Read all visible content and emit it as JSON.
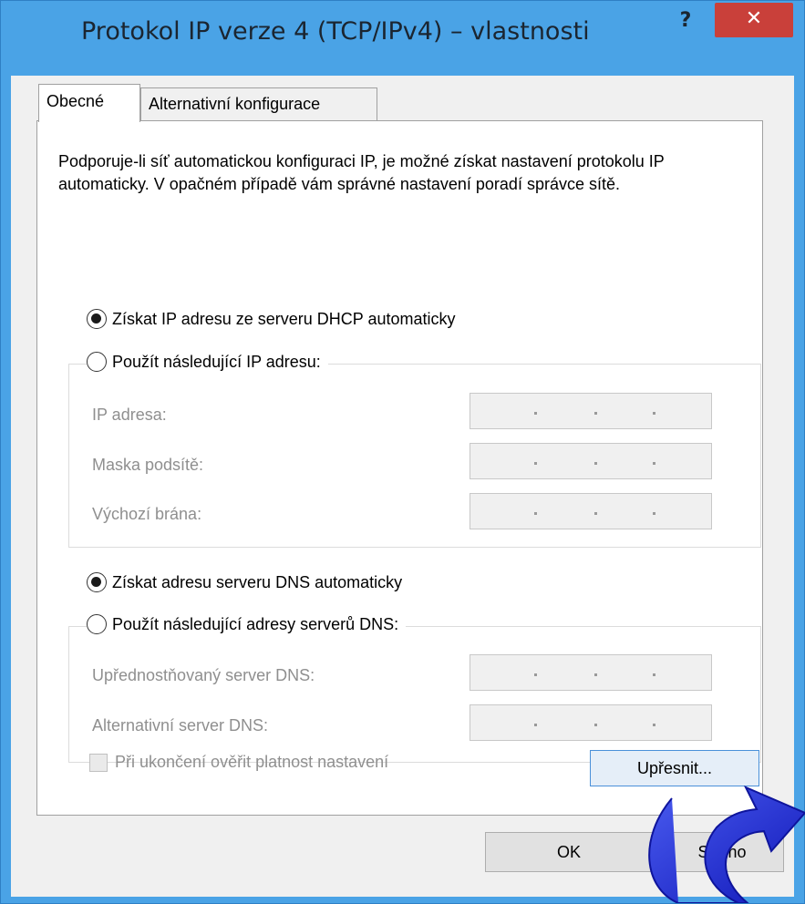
{
  "window": {
    "title": "Protokol IP verze 4 (TCP/IPv4) – vlastnosti",
    "help_label": "?",
    "close_label": "✕"
  },
  "tabs": [
    {
      "label": "Obecné",
      "active": true
    },
    {
      "label": "Alternativní konfigurace",
      "active": false
    }
  ],
  "description": "Podporuje-li síť automatickou konfiguraci IP, je možné získat nastavení protokolu IP automaticky. V opačném případě vám správné nastavení poradí správce sítě.",
  "ip": {
    "auto_label": "Získat IP adresu ze serveru DHCP automaticky",
    "auto_checked": true,
    "manual_label": "Použít následující IP adresu:",
    "fields": [
      {
        "label": "IP adresa:",
        "value": ". . ."
      },
      {
        "label": "Maska podsítě:",
        "value": ". . ."
      },
      {
        "label": "Výchozí brána:",
        "value": ". . ."
      }
    ]
  },
  "dns": {
    "auto_label": "Získat adresu serveru DNS automaticky",
    "auto_checked": true,
    "manual_label": "Použít následující adresy serverů DNS:",
    "fields": [
      {
        "label": "Upřednostňovaný server DNS:",
        "value": ". . ."
      },
      {
        "label": "Alternativní server DNS:",
        "value": ". . ."
      }
    ]
  },
  "validate_label": "Při ukončení ověřit platnost nastavení",
  "buttons": {
    "advanced": "Upřesnit...",
    "ok": "OK",
    "cancel": "Storno"
  },
  "colors": {
    "frame": "#4aa3e6",
    "close": "#c9403a",
    "arrow": "#1c2ccf"
  },
  "icons": [
    "help-icon",
    "close-icon",
    "curved-arrow-icon"
  ]
}
